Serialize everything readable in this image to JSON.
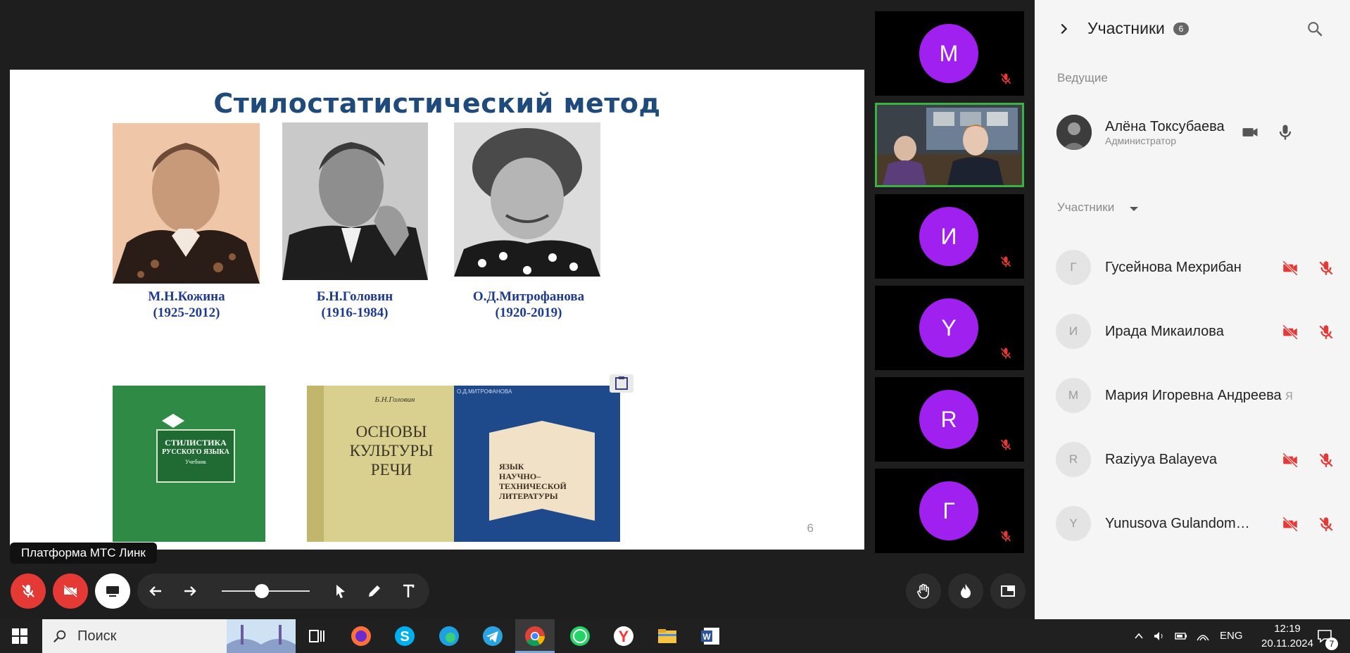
{
  "slide": {
    "title": "Стилостатистический  метод",
    "people": [
      {
        "name": "М.Н.Кожина",
        "years": "(1925-2012)"
      },
      {
        "name": "Б.Н.Головин",
        "years": "(1916-1984)"
      },
      {
        "name": "О.Д.Митрофанова",
        "years": "(1920-2019)"
      }
    ],
    "books": [
      {
        "title_line1": "СТИЛИСТИКА",
        "title_line2": "РУССКОГО ЯЗЫКА",
        "subtitle": "Учебник"
      },
      {
        "author": "Б.Н.Головин",
        "title_line1": "ОСНОВЫ",
        "title_line2": "КУЛЬТУРЫ",
        "title_line3": "РЕЧИ"
      },
      {
        "author": "О.Д.МИТРОФАНОВА",
        "title_line1": "ЯЗЫК",
        "title_line2": "НАУЧНО–",
        "title_line3": "ТЕХНИЧЕСКОЙ",
        "title_line4": "ЛИТЕРАТУРЫ"
      }
    ],
    "page_number": "6"
  },
  "tooltip": "Платформа МТС Линк",
  "tiles": [
    {
      "initial": "М"
    },
    {
      "initial": ""
    },
    {
      "initial": "И"
    },
    {
      "initial": "Y"
    },
    {
      "initial": "R"
    },
    {
      "initial": "Г"
    }
  ],
  "panel": {
    "title": "Участники",
    "count": "6",
    "hosts_label": "Ведущие",
    "host": {
      "name": "Алёна Токсубаева",
      "role": "Администратор"
    },
    "members_label": "Участники",
    "members": [
      {
        "initial": "Г",
        "name": "Гусейнова Мехрибан"
      },
      {
        "initial": "И",
        "name": "Ирада Микаилова"
      },
      {
        "initial": "М",
        "name": "Мария Игоревна Андреева",
        "suffix": "я"
      },
      {
        "initial": "R",
        "name": "Raziyya Balayeva"
      },
      {
        "initial": "Y",
        "name": "Yunusova Gulandom Gulomovna"
      }
    ]
  },
  "taskbar": {
    "search_placeholder": "Поиск",
    "language": "ENG",
    "time": "12:19",
    "date": "20.11.2024",
    "notifications": "7"
  },
  "colors": {
    "accent_purple": "#a020f0",
    "mute_red": "#e53935",
    "active_tile_border": "#3cb043",
    "slide_title": "#1f4a7c"
  }
}
